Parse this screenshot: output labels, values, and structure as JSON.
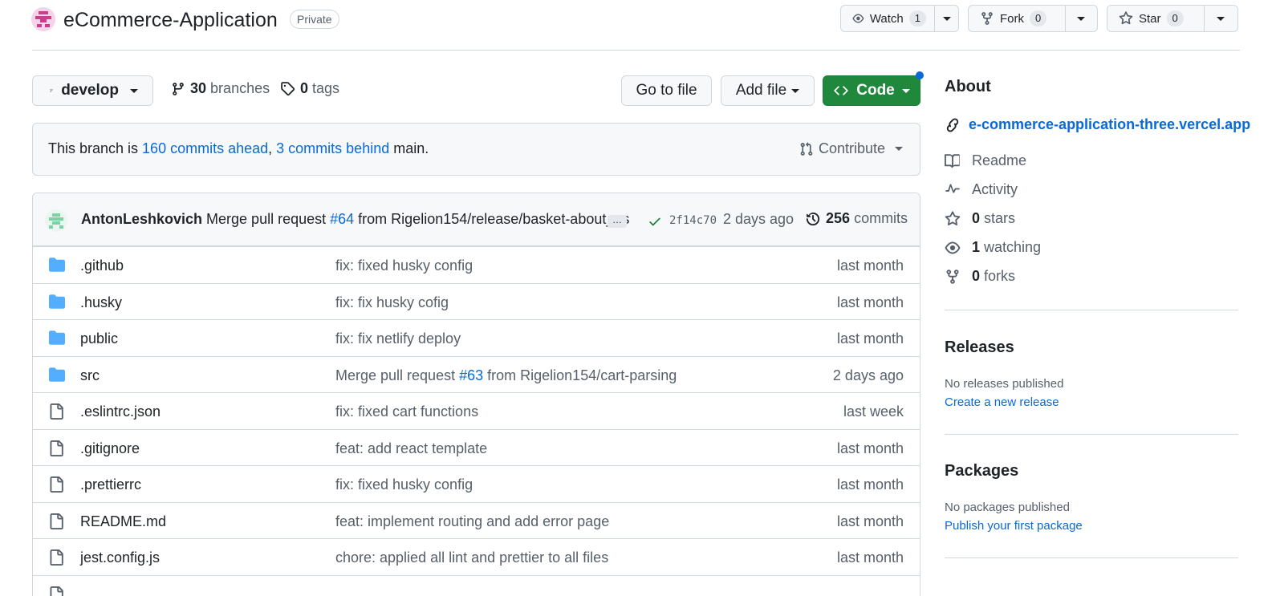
{
  "repo": {
    "name": "eCommerce-Application",
    "visibility": "Private"
  },
  "header_actions": {
    "watch": {
      "label": "Watch",
      "count": "1"
    },
    "fork": {
      "label": "Fork",
      "count": "0"
    },
    "star": {
      "label": "Star",
      "count": "0"
    }
  },
  "toolbar": {
    "branch": "develop",
    "branches_count": "30",
    "branches_label": "branches",
    "tags_count": "0",
    "tags_label": "tags",
    "go_to_file": "Go to file",
    "add_file": "Add file",
    "code": "Code"
  },
  "branch_status": {
    "prefix": "This branch is ",
    "ahead": "160 commits ahead",
    "separator": ", ",
    "behind": "3 commits behind",
    "suffix": " main.",
    "contribute": "Contribute"
  },
  "latest_commit": {
    "author": "AntonLeshkovich",
    "message_prefix": "Merge pull request ",
    "pr": "#64",
    "message_suffix": " from Rigelion154/release/basket-about_us",
    "ellipsis": "…",
    "sha": "2f14c70",
    "date": "2 days ago",
    "commits_count": "256",
    "commits_label": "commits"
  },
  "files": [
    {
      "type": "folder",
      "name": ".github",
      "message": "fix: fixed husky config",
      "date": "last month"
    },
    {
      "type": "folder",
      "name": ".husky",
      "message": "fix: fix husky cofig",
      "date": "last month"
    },
    {
      "type": "folder",
      "name": "public",
      "message": "fix: fix netlify deploy",
      "date": "last month"
    },
    {
      "type": "folder",
      "name": "src",
      "message_prefix": "Merge pull request ",
      "message_pr": "#63",
      "message_suffix": " from Rigelion154/cart-parsing",
      "date": "2 days ago"
    },
    {
      "type": "file",
      "name": ".eslintrc.json",
      "message": "fix: fixed cart functions",
      "date": "last week"
    },
    {
      "type": "file",
      "name": ".gitignore",
      "message": "feat: add react template",
      "date": "last month"
    },
    {
      "type": "file",
      "name": ".prettierrc",
      "message": "fix: fixed husky config",
      "date": "last month"
    },
    {
      "type": "file",
      "name": "README.md",
      "message": "feat: implement routing and add error page",
      "date": "last month"
    },
    {
      "type": "file",
      "name": "jest.config.js",
      "message": "chore: applied all lint and prettier to all files",
      "date": "last month"
    }
  ],
  "about": {
    "title": "About",
    "website": "e-commerce-application-three.vercel.app",
    "readme": "Readme",
    "activity": "Activity",
    "stars_count": "0",
    "stars_label": "stars",
    "watching_count": "1",
    "watching_label": "watching",
    "forks_count": "0",
    "forks_label": "forks"
  },
  "releases": {
    "title": "Releases",
    "empty": "No releases published",
    "create": "Create a new release"
  },
  "packages": {
    "title": "Packages",
    "empty": "No packages published",
    "publish": "Publish your first package"
  },
  "colors": {
    "accent_link": "#0969da",
    "primary_green": "#1f883d",
    "folder_blue": "#54aeff",
    "notification_dot": "#0969da"
  }
}
